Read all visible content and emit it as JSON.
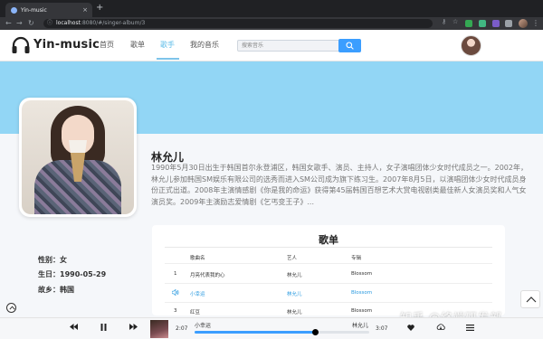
{
  "browser": {
    "tab_title": "Yin-music",
    "tab_close": "×",
    "new_tab": "+",
    "url_host": "localhost",
    "url_path": ":8080/#/singer-album/3"
  },
  "header": {
    "logo_text": "Yin-music",
    "nav": [
      "首页",
      "歌单",
      "歌手",
      "我的音乐"
    ],
    "active_nav": "歌手",
    "search_placeholder": "搜索音乐"
  },
  "singer": {
    "name": "林允儿",
    "intro": "1990年5月30日出生于韩国首尔永登浦区，韩国女歌手、演员、主持人，女子演唱团体少女时代成员之一。2002年，林允儿参加韩国SM娱乐有限公司的选秀而进入SM公司成为旗下练习生。2007年8月5日，以演唱团体少女时代成员身份正式出道。2008年主演情感剧《你是我的命运》获得第45届韩国百想艺术大赏电视剧类最佳新人女演员奖和人气女演员奖。2009年主演励志爱情剧《乞丐变王子》...",
    "gender_label": "性别：",
    "gender": "女",
    "birthday_label": "生日：",
    "birthday": "1990-05-29",
    "hometown_label": "故乡：",
    "hometown": "韩国"
  },
  "songs": {
    "title": "歌单",
    "columns": [
      "歌曲名",
      "艺人",
      "专辑"
    ],
    "rows": [
      {
        "index": "1",
        "name": "月亮代表我的心",
        "artist": "林允儿",
        "album": "Blossom",
        "playing": false
      },
      {
        "index": "",
        "name": "小幸运",
        "artist": "林允儿",
        "album": "Blossom",
        "playing": true
      },
      {
        "index": "3",
        "name": "红豆",
        "artist": "林允儿",
        "album": "Blossom",
        "playing": false
      }
    ]
  },
  "player": {
    "current_time": "2:07",
    "total_time": "3:07",
    "song_title": "小幸运",
    "artist": "林允儿",
    "progress": 0.69
  },
  "watermark": "知乎 @终端研发部",
  "colors": {
    "accent": "#3b9eff",
    "banner": "#92d6f5",
    "active_nav": "#5fbde9"
  }
}
